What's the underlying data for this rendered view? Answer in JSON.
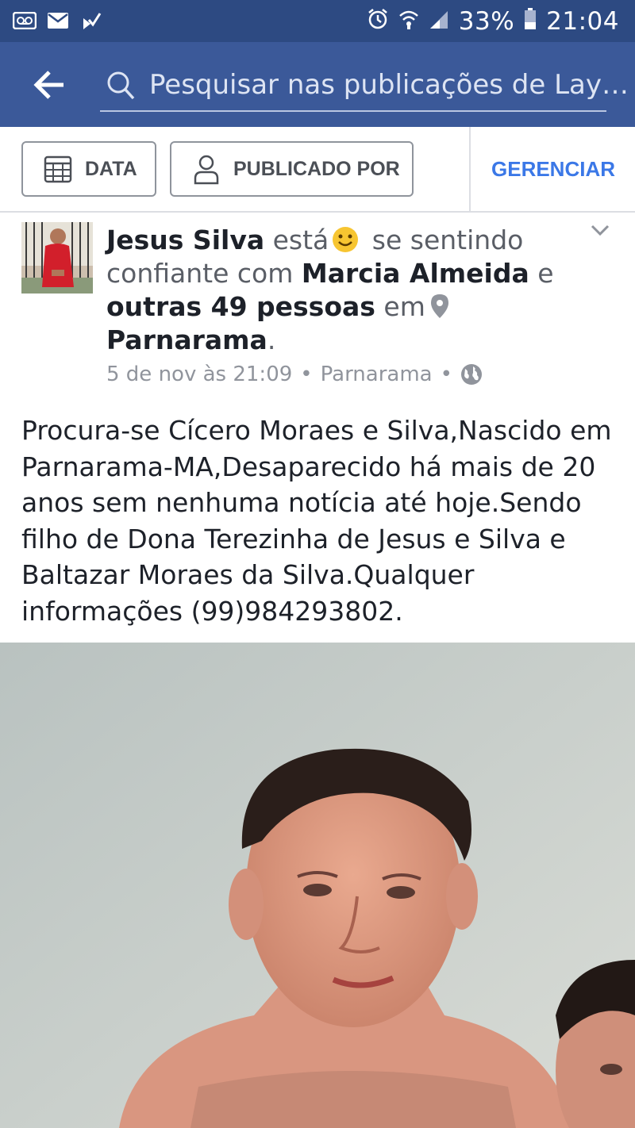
{
  "status_bar": {
    "icons_left": [
      "voicemail-icon",
      "mail-icon",
      "check-flag-icon"
    ],
    "icons_right": [
      "alarm-icon",
      "wifi-icon",
      "signal-icon",
      "battery-icon"
    ],
    "battery": "33%",
    "time": "21:04"
  },
  "header": {
    "search_placeholder": "Pesquisar nas publicações de Lay…",
    "bg_color": "#3b5999"
  },
  "filters": {
    "date_label": "DATA",
    "posted_by_label": "PUBLICADO POR",
    "manage_label": "GERENCIAR",
    "manage_color": "#3b78e7"
  },
  "post": {
    "author": "Jesus Silva",
    "verb": "está",
    "feeling": "se sentindo confiante com",
    "with_name": "Marcia Almeida",
    "and": "e",
    "others": "outras 49 pessoas",
    "at": "em",
    "place": "Parnarama",
    "date": "5 de nov às 21:09",
    "location": "Parnarama",
    "separator": "•",
    "text": "Procura-se Cícero Moraes e Silva,Nascido em Parnarama-MA,Desaparecido há  mais de 20 anos sem nenhuma notícia até hoje.Sendo filho de Dona Terezinha de Jesus e Silva e Baltazar Moraes da Silva.Qualquer informações (99)984293802."
  }
}
